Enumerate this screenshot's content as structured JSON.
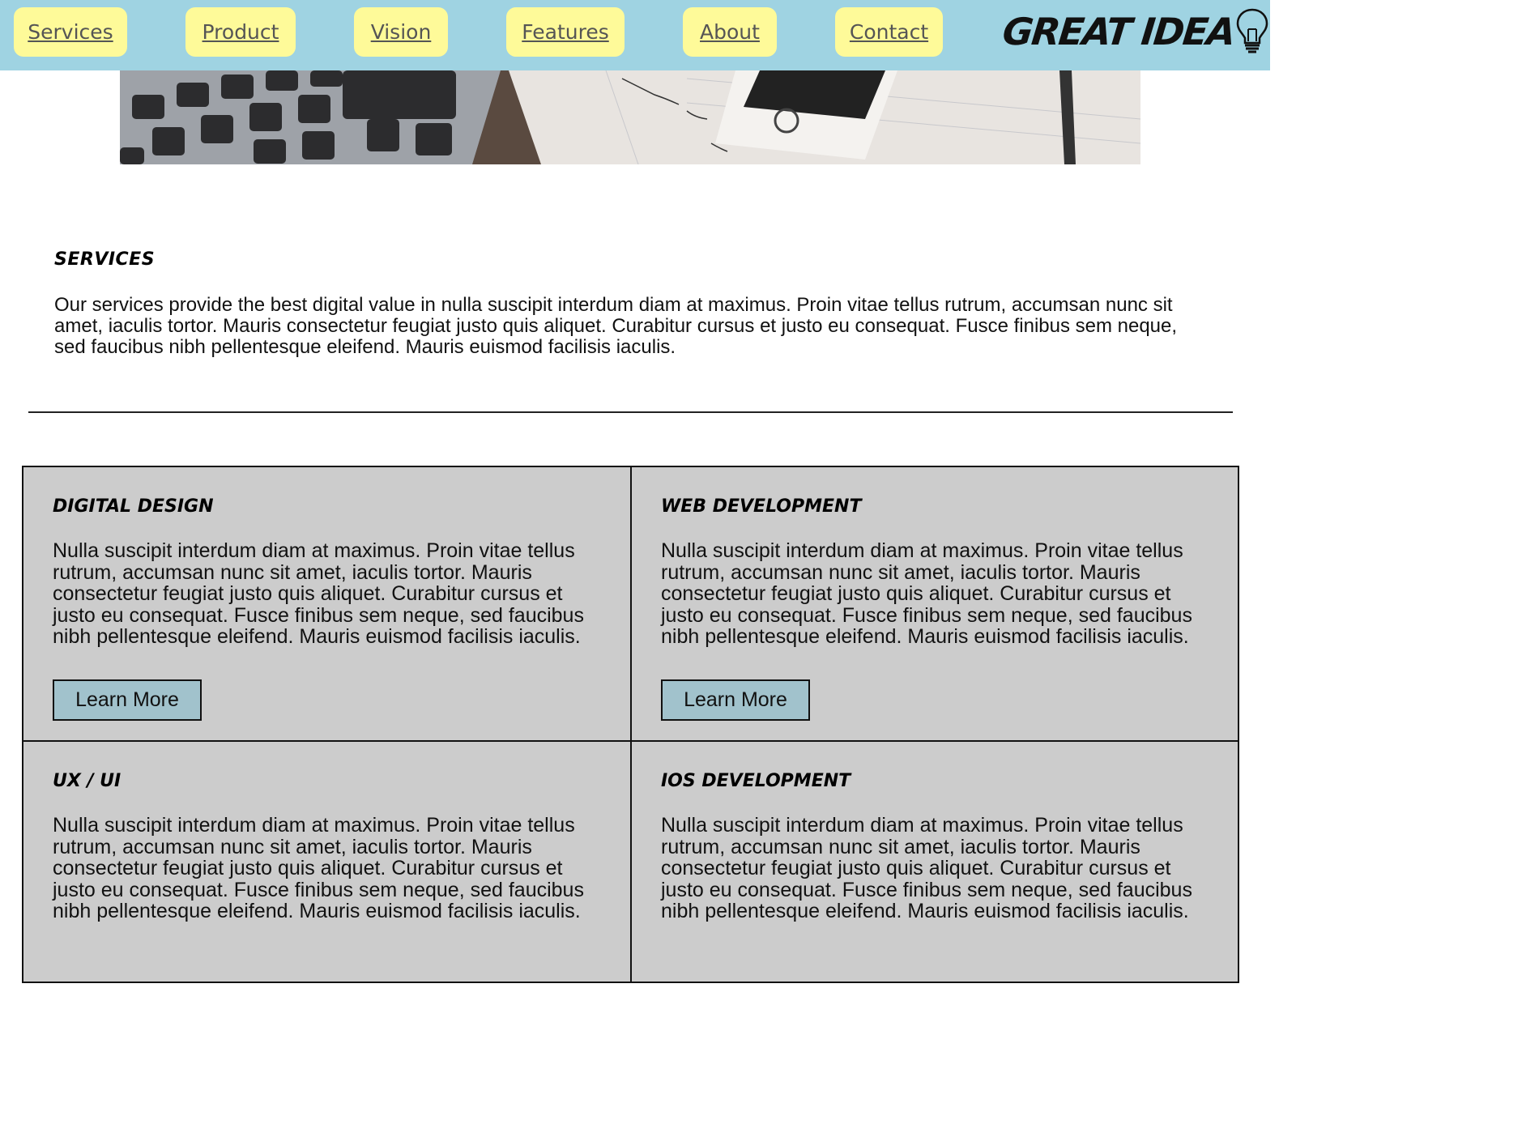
{
  "nav": {
    "items": [
      {
        "label": "Services"
      },
      {
        "label": "Product"
      },
      {
        "label": "Vision"
      },
      {
        "label": "Features"
      },
      {
        "label": "About"
      },
      {
        "label": "Contact"
      }
    ]
  },
  "logo": {
    "text": "GREAT IDEA",
    "icon": "lightbulb-icon"
  },
  "hero": {
    "image": "laptop-keyboard-phone-notebook-photo"
  },
  "services": {
    "title": "Services",
    "text": "Our services provide the best digital value in nulla suscipit interdum diam at maximus. Proin vitae tellus rutrum, accumsan nunc sit amet, iaculis tortor. Mauris consectetur feugiat justo quis aliquet. Curabitur cursus et justo eu consequat. Fusce finibus sem neque, sed faucibus nibh pellentesque eleifend. Mauris euismod facilisis iaculis."
  },
  "cards": [
    {
      "title": "Digital Design",
      "text": "Nulla suscipit interdum diam at maximus. Proin vitae tellus rutrum, accumsan nunc sit amet, iaculis tortor. Mauris consectetur feugiat justo quis aliquet. Curabitur cursus et justo eu consequat. Fusce finibus sem neque, sed faucibus nibh pellentesque eleifend. Mauris euismod facilisis iaculis.",
      "button": "Learn More"
    },
    {
      "title": "Web Development",
      "text": "Nulla suscipit interdum diam at maximus. Proin vitae tellus rutrum, accumsan nunc sit amet, iaculis tortor. Mauris consectetur feugiat justo quis aliquet. Curabitur cursus et justo eu consequat. Fusce finibus sem neque, sed faucibus nibh pellentesque eleifend. Mauris euismod facilisis iaculis.",
      "button": "Learn More"
    },
    {
      "title": "UX / UI",
      "text": "Nulla suscipit interdum diam at maximus. Proin vitae tellus rutrum, accumsan nunc sit amet, iaculis tortor. Mauris consectetur feugiat justo quis aliquet. Curabitur cursus et justo eu consequat. Fusce finibus sem neque, sed faucibus nibh pellentesque eleifend. Mauris euismod facilisis iaculis."
    },
    {
      "title": "iOS Development",
      "text": "Nulla suscipit interdum diam at maximus. Proin vitae tellus rutrum, accumsan nunc sit amet, iaculis tortor. Mauris consectetur feugiat justo quis aliquet. Curabitur cursus et justo eu consequat. Fusce finibus sem neque, sed faucibus nibh pellentesque eleifend. Mauris euismod facilisis iaculis."
    }
  ],
  "colors": {
    "navbar": "#9fd3e2",
    "nav_item": "#fefa99",
    "card": "#cccccc",
    "button": "#a1c2cc"
  }
}
